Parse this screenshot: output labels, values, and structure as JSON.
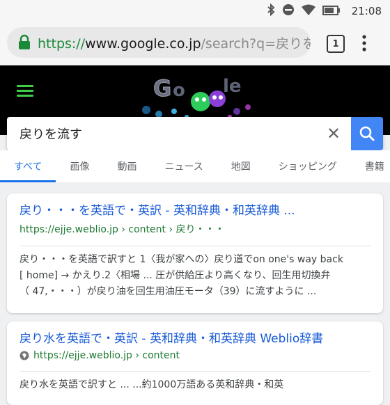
{
  "status_bar": {
    "time": "21:08"
  },
  "address_bar": {
    "url_scheme": "https://",
    "url_domain": "www.google.co.jp",
    "url_path": "/search?q=戻りを流す",
    "tab_count": "1"
  },
  "search": {
    "query": "戻りを流す"
  },
  "tabs": [
    {
      "label": "すべて"
    },
    {
      "label": "画像"
    },
    {
      "label": "動画"
    },
    {
      "label": "ニュース"
    },
    {
      "label": "地図"
    },
    {
      "label": "ショッピング"
    },
    {
      "label": "書籍"
    }
  ],
  "results": [
    {
      "title": "戻り・・・を英語で・英訳 - 英和辞典・和英辞典 ...",
      "url": "https://ejje.weblio.jp › content › 戻り・・・",
      "snippet": [
        "戻り・・・を英語で訳すと 1〈我が家への〉戻り道でon one's way back",
        "[ home] → かえり.2〈相場 ... 圧が供給圧より高くなり、回生用切換弁",
        "（ 47,・・・）が戻り油を回生用油圧モータ（39）に流すように ..."
      ]
    },
    {
      "title": "戻り水を英語で・英訳 - 英和辞典・和英辞典 Weblio辞書",
      "url": "https://ejje.weblio.jp › content",
      "snippet": [
        "戻り水を英語で訳すと ... ...約1000万語ある英和辞典・和英"
      ]
    }
  ],
  "colors": {
    "accent": "#4285f4",
    "link": "#1558d6",
    "url_green": "#1e7a32"
  }
}
